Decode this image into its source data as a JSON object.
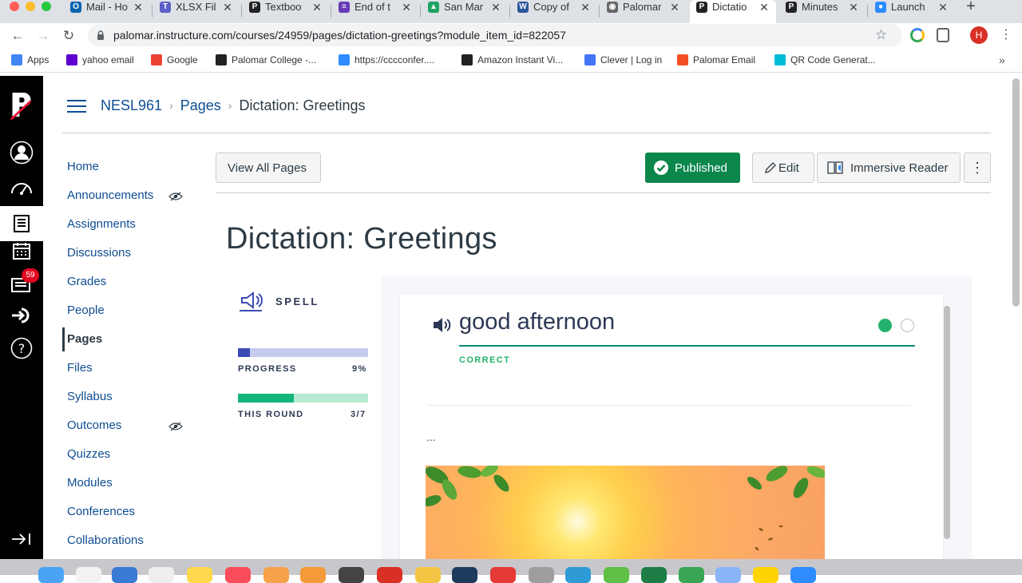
{
  "browser": {
    "tabs": [
      {
        "title": "Mail - Ho",
        "color": "#0a64ad",
        "glyph": "O"
      },
      {
        "title": "XLSX Fil",
        "color": "#5b5fc7",
        "glyph": "T"
      },
      {
        "title": "Textboo",
        "color": "#222222",
        "glyph": "P"
      },
      {
        "title": "End of t",
        "color": "#673ab7",
        "glyph": "≡"
      },
      {
        "title": "San Mar",
        "color": "#1fa463",
        "glyph": "▲"
      },
      {
        "title": "Copy of",
        "color": "#2b579a",
        "glyph": "W"
      },
      {
        "title": "Palomar",
        "color": "#666666",
        "glyph": "◉"
      },
      {
        "title": "Dictatio",
        "color": "#222222",
        "glyph": "P"
      },
      {
        "title": "Minutes",
        "color": "#222222",
        "glyph": "P"
      },
      {
        "title": "Launch",
        "color": "#2d8cff",
        "glyph": "●"
      }
    ],
    "new_tab": "+",
    "url": "palomar.instructure.com/courses/24959/pages/dictation-greetings?module_item_id=822057",
    "profile_initial": "H",
    "bookmarks": [
      {
        "label": "Apps",
        "color": "#4285f4"
      },
      {
        "label": "yahoo email",
        "color": "#5f01d1"
      },
      {
        "label": "Google",
        "color": "#ea4335"
      },
      {
        "label": "Palomar College -...",
        "color": "#222222"
      },
      {
        "label": "https://cccconfer....",
        "color": "#2d8cff"
      },
      {
        "label": "Amazon Instant Vi...",
        "color": "#222222"
      },
      {
        "label": "Clever | Log in",
        "color": "#4274f6"
      },
      {
        "label": "Palomar Email",
        "color": "#f25022"
      },
      {
        "label": "QR Code Generat...",
        "color": "#00bcd4"
      }
    ],
    "bookmarks_more": "»"
  },
  "global_nav": {
    "badge": "59"
  },
  "breadcrumb": {
    "course": "NESL961",
    "section": "Pages",
    "current": "Dictation: Greetings",
    "separator": "›"
  },
  "course_nav": [
    {
      "label": "Home"
    },
    {
      "label": "Announcements",
      "hidden_icon": true
    },
    {
      "label": "Assignments"
    },
    {
      "label": "Discussions"
    },
    {
      "label": "Grades"
    },
    {
      "label": "People"
    },
    {
      "label": "Pages",
      "active": true
    },
    {
      "label": "Files"
    },
    {
      "label": "Syllabus"
    },
    {
      "label": "Outcomes",
      "hidden_icon": true
    },
    {
      "label": "Quizzes"
    },
    {
      "label": "Modules"
    },
    {
      "label": "Conferences"
    },
    {
      "label": "Collaborations"
    }
  ],
  "toolbar": {
    "view_all": "View All Pages",
    "published": "Published",
    "edit": "Edit",
    "immersive": "Immersive Reader",
    "more": "⋮"
  },
  "page": {
    "title": "Dictation: Greetings"
  },
  "activity": {
    "mode_label": "SPELL",
    "progress_label": "PROGRESS",
    "progress_value": "9%",
    "progress_fraction": 0.09,
    "round_label": "THIS ROUND",
    "round_value": "3/7",
    "round_fraction": 0.4286,
    "term": "good afternoon",
    "status": "CORRECT",
    "ellipsis": "..."
  },
  "colors": {
    "published_green": "#0b874b",
    "link_blue": "#0e4d92",
    "progress_blue": "#3c4bb4",
    "progress_blue_bg": "#c5cbee",
    "round_green": "#12b57a",
    "round_green_bg": "#b6ead2",
    "correct_green": "#23b26d"
  }
}
